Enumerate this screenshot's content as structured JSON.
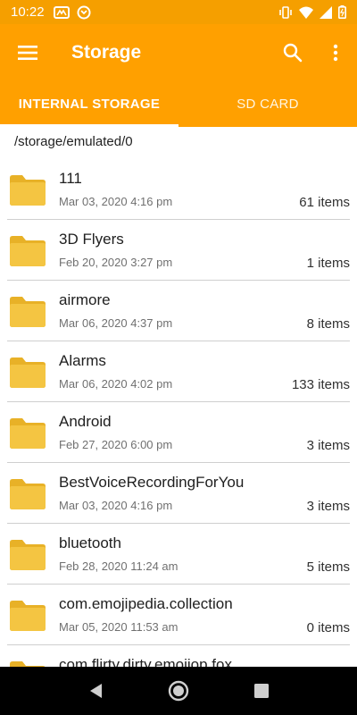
{
  "status_bar": {
    "time": "10:22",
    "left_icons": [
      "notification-app-icon",
      "sync-icon"
    ],
    "right_icons": [
      "vibrate-icon",
      "wifi-icon",
      "signal-icon",
      "battery-icon"
    ]
  },
  "app_bar": {
    "title": "Storage",
    "menu_icon": "hamburger-menu-icon",
    "actions": [
      "search-icon",
      "more-vert-icon"
    ]
  },
  "tabs": [
    {
      "label": "INTERNAL STORAGE",
      "active": true
    },
    {
      "label": "SD CARD",
      "active": false
    }
  ],
  "path": "/storage/emulated/0",
  "colors": {
    "primary": "#ffa000",
    "status_bar": "#f59f00",
    "folder": "#f4c542",
    "folder_dark": "#e8b127"
  },
  "folders": [
    {
      "name": "111",
      "date": "Mar 03, 2020 4:16 pm",
      "count": "61 items"
    },
    {
      "name": "3D Flyers",
      "date": "Feb 20, 2020 3:27 pm",
      "count": "1 items"
    },
    {
      "name": "airmore",
      "date": "Mar 06, 2020 4:37 pm",
      "count": "8 items"
    },
    {
      "name": "Alarms",
      "date": "Mar 06, 2020 4:02 pm",
      "count": "133 items"
    },
    {
      "name": "Android",
      "date": "Feb 27, 2020 6:00 pm",
      "count": "3 items"
    },
    {
      "name": "BestVoiceRecordingForYou",
      "date": "Mar 03, 2020 4:16 pm",
      "count": "3 items"
    },
    {
      "name": "bluetooth",
      "date": "Feb 28, 2020 11:24 am",
      "count": "5 items"
    },
    {
      "name": "com.emojipedia.collection",
      "date": "Mar 05, 2020 11:53 am",
      "count": "0 items"
    },
    {
      "name": "com.flirty.dirty.emojiop.fox",
      "date": "",
      "count": ""
    }
  ],
  "nav_bar": [
    "back-icon",
    "home-icon",
    "recents-icon"
  ]
}
